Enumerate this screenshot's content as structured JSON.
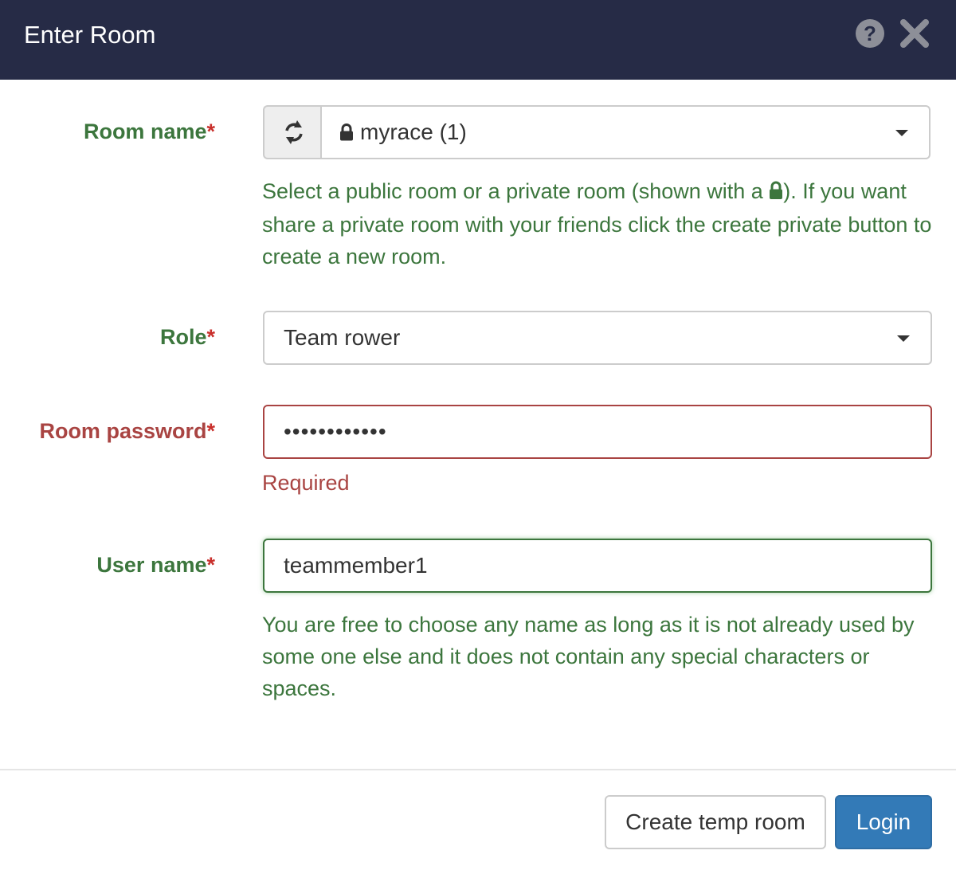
{
  "dialog": {
    "title": "Enter Room",
    "help_label": "?"
  },
  "form": {
    "required_mark": "*",
    "room": {
      "label": "Room name",
      "selected": "myrace (1)",
      "help_before_icon": "Select a public room or a private room (shown with a ",
      "help_after_icon": "). If you want share a private room with your friends click the create private button to create a new room."
    },
    "role": {
      "label": "Role",
      "selected": "Team rower"
    },
    "password": {
      "label": "Room password",
      "value": "••••••••••••",
      "error": "Required"
    },
    "username": {
      "label": "User name",
      "value": "teammember1",
      "help": "You are free to choose any name as long as it is not already used by some one else and it does not contain any special characters or spaces."
    }
  },
  "footer": {
    "create_temp_room_label": "Create temp room",
    "login_label": "Login"
  },
  "colors": {
    "header": "#262b46",
    "success": "#3c763d",
    "error": "#a94442",
    "primary": "#337ab7"
  },
  "icons": {
    "refresh": "refresh-icon",
    "lock": "lock-icon",
    "help": "question-circle-icon",
    "close": "close-icon",
    "dropdown": "caret-down-icon"
  }
}
